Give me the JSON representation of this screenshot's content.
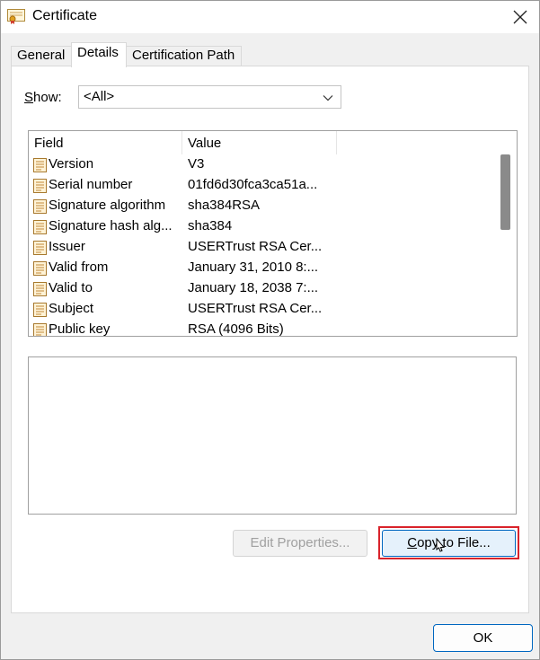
{
  "window": {
    "title": "Certificate",
    "title_icon": "certificate-icon",
    "close_icon": "close-icon"
  },
  "tabs": [
    {
      "label": "General",
      "active": false
    },
    {
      "label": "Details",
      "active": true
    },
    {
      "label": "Certification Path",
      "active": false
    }
  ],
  "show": {
    "label_prefix": "S",
    "label_rest": "how:",
    "selected": "<All>",
    "chevron_icon": "chevron-down-icon"
  },
  "list": {
    "columns": [
      "Field",
      "Value"
    ],
    "rows": [
      {
        "field": "Version",
        "value": "V3"
      },
      {
        "field": "Serial number",
        "value": "01fd6d30fca3ca51a..."
      },
      {
        "field": "Signature algorithm",
        "value": "sha384RSA"
      },
      {
        "field": "Signature hash alg...",
        "value": "sha384"
      },
      {
        "field": "Issuer",
        "value": "USERTrust RSA Cer..."
      },
      {
        "field": "Valid from",
        "value": "January 31, 2010 8:..."
      },
      {
        "field": "Valid to",
        "value": "January 18, 2038 7:..."
      },
      {
        "field": "Subject",
        "value": "USERTrust RSA Cer..."
      },
      {
        "field": "Public key",
        "value": "RSA (4096 Bits)"
      }
    ]
  },
  "buttons": {
    "edit_properties": "Edit Properties...",
    "copy_prefix": "C",
    "copy_rest": "opy to File...",
    "ok": "OK"
  },
  "colors": {
    "accent": "#0067c0",
    "highlight": "#d9232b"
  }
}
